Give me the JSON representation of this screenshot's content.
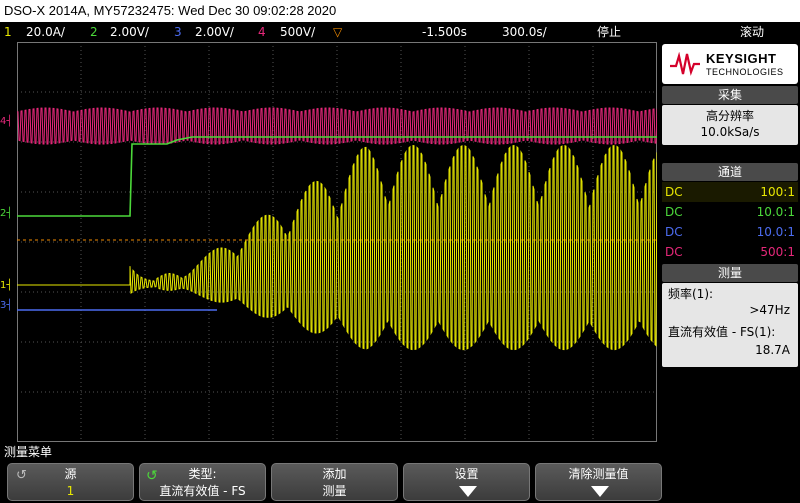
{
  "title": "DSO-X 2014A, MY57232475: Wed Dec 30 09:02:28 2020",
  "channels": [
    {
      "num": "1",
      "scale": "20.0A/",
      "color": "#e8e800"
    },
    {
      "num": "2",
      "scale": "2.00V/",
      "color": "#4cd93a"
    },
    {
      "num": "3",
      "scale": "2.00V/",
      "color": "#4c6cf0"
    },
    {
      "num": "4",
      "scale": "500V/",
      "color": "#e6287a"
    }
  ],
  "timebase": {
    "delay": "-1.500s",
    "scale": "300.0s/"
  },
  "run_state": "停止",
  "trigger_mode": "滚动",
  "colors": {
    "ch1": "#e8e800",
    "ch2": "#4cd93a",
    "ch3": "#4c6cf0",
    "ch4": "#e6287a",
    "grid": "#555555",
    "panel_head": "#4a4a4a"
  },
  "panel": {
    "logo_line1": "KEYSIGHT",
    "logo_line2": "TECHNOLOGIES",
    "acquire": {
      "header": "采集",
      "mode": "高分辨率",
      "rate": "10.0kSa/s"
    },
    "channels": {
      "header": "通道",
      "rows": [
        {
          "coupling": "DC",
          "probe": "100:1"
        },
        {
          "coupling": "DC",
          "probe": "10.0:1"
        },
        {
          "coupling": "DC",
          "probe": "10.0:1"
        },
        {
          "coupling": "DC",
          "probe": "500:1"
        }
      ]
    },
    "measure": {
      "header": "测量",
      "items": [
        {
          "label": "频率(1):",
          "value": ">47Hz"
        },
        {
          "label": "直流有效值 - FS(1):",
          "value": "18.7A"
        }
      ]
    }
  },
  "menu": {
    "title": "测量菜单",
    "keys": [
      {
        "line1": "源",
        "line2": "1",
        "icon": "rotate-icon"
      },
      {
        "line1": "类型:",
        "line2": "直流有效值 - FS",
        "icon": "rotate-green-icon"
      },
      {
        "line1": "添加",
        "line2": "测量",
        "icon": ""
      },
      {
        "line1": "设置",
        "line2": "",
        "icon": "arrow-down-icon"
      },
      {
        "line1": "清除测量值",
        "line2": "",
        "icon": "arrow-down-icon"
      }
    ]
  }
}
